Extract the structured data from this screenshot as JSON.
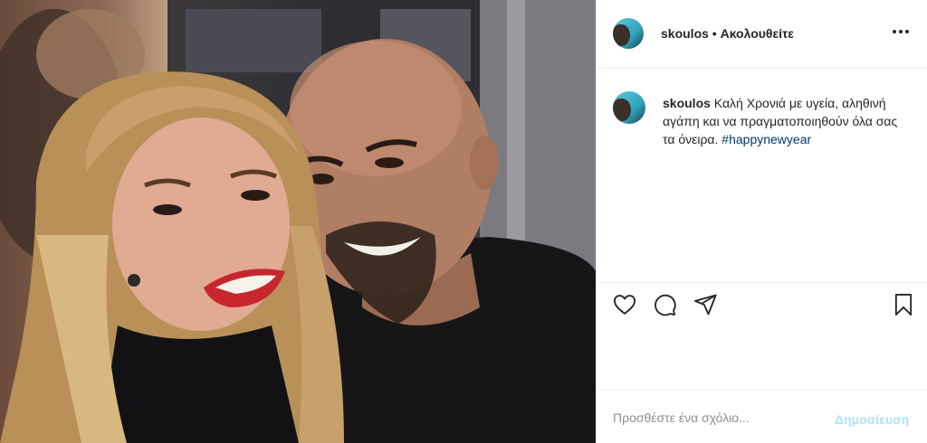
{
  "post": {
    "username": "skoulos",
    "follow_status": "• Ακολουθείτε",
    "caption_text": "Καλή Χρονιά με υγεία, αληθινή αγάπη και να πραγματοποιηθούν όλα σας τα όνειρα.",
    "hashtag": "#happynewyear"
  },
  "icons": {
    "more": "more-horizontal-icon",
    "like": "heart-icon",
    "comment": "comment-bubble-icon",
    "share": "send-paper-plane-icon",
    "save": "bookmark-icon"
  },
  "comment_box": {
    "placeholder": "Προσθέστε ένα σχόλιο...",
    "publish_label": "Δημοσίευση"
  },
  "colors": {
    "hashtag": "#00376b",
    "publish_disabled": "#b2dffc",
    "border": "#efefef",
    "text": "#262626"
  }
}
